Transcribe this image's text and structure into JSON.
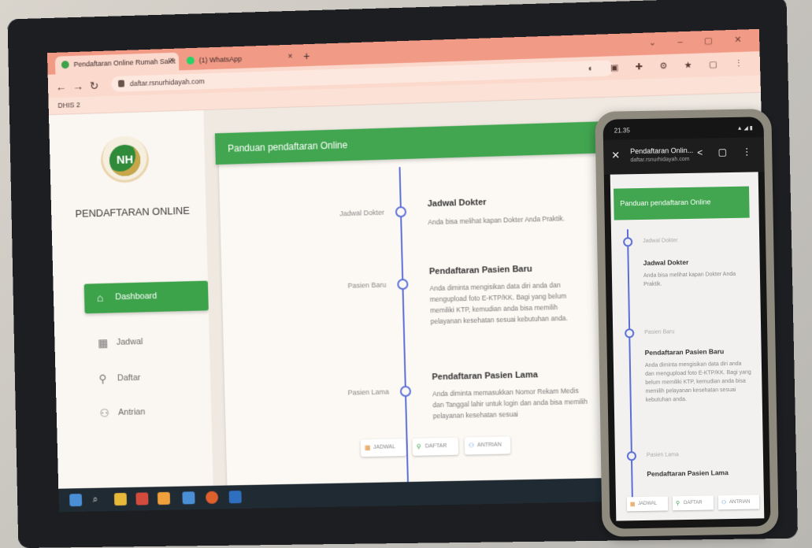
{
  "browser": {
    "tabs": [
      {
        "label": "Pendaftaran Online Rumah Sakit",
        "active": true,
        "favicon_color": "#3da34b"
      },
      {
        "label": "(1) WhatsApp",
        "active": false,
        "favicon_color": "#25d366"
      }
    ],
    "url": "daftar.rsnurhidayah.com",
    "bookmark": "DHIS 2"
  },
  "sidebar": {
    "logo_text": "NH",
    "title": "PENDAFTARAN ONLINE",
    "items": [
      {
        "label": "Dashboard",
        "icon": "home-icon",
        "active": true
      },
      {
        "label": "Jadwal",
        "icon": "calendar-icon",
        "active": false
      },
      {
        "label": "Daftar",
        "icon": "user-add-icon",
        "active": false
      },
      {
        "label": "Antrian",
        "icon": "users-icon",
        "active": false
      }
    ]
  },
  "main": {
    "card_title": "Panduan pendaftaran Online",
    "timeline": [
      {
        "left_label": "Jadwal Dokter",
        "title": "Jadwal Dokter",
        "text": "Anda bisa melihat kapan Dokter Anda Praktik."
      },
      {
        "left_label": "Pasien Baru",
        "title": "Pendaftaran Pasien Baru",
        "text": "Anda diminta mengisikan data diri anda dan mengupload foto E-KTP/KK. Bagi yang belum memiliki KTP, kemudian anda bisa memilih pelayanan kesehatan sesuai kebutuhan anda."
      },
      {
        "left_label": "Pasien Lama",
        "title": "Pendaftaran Pasien Lama",
        "text": "Anda diminta memasukkan Nomor Rekam Medis dan Tanggal lahir untuk login dan anda bisa memilih pelayanan kesehatan sesuai"
      }
    ],
    "bottom_buttons": [
      {
        "label": "JADWAL",
        "icon": "calendar-icon",
        "color": "#e28a2b"
      },
      {
        "label": "DAFTAR",
        "icon": "user-add-icon",
        "color": "#3da34b"
      },
      {
        "label": "ANTRIAN",
        "icon": "users-icon",
        "color": "#4a90d9"
      }
    ]
  },
  "phone": {
    "time": "21.35",
    "page_title": "Pendaftaran Onlin...",
    "url": "daftar.rsnurhidayah.com",
    "card_title": "Panduan pendaftaran Online",
    "timeline": [
      {
        "small": "Jadwal Dokter",
        "title": "Jadwal Dokter",
        "text": "Anda bisa melihat kapan Dokter Anda Praktik."
      },
      {
        "small": "Pasien Baru",
        "title": "Pendaftaran Pasien Baru",
        "text": "Anda diminta mengisikan data diri anda dan mengupload foto E-KTP/KK. Bagi yang belum memiliki KTP, kemudian anda bisa memilih pelayanan kesehatan sesuai kebutuhan anda."
      },
      {
        "small": "Pasien Lama",
        "title": "Pendaftaran Pasien Lama",
        "text": ""
      }
    ],
    "bottom_buttons": [
      {
        "label": "JADWAL"
      },
      {
        "label": "DAFTAR"
      },
      {
        "label": "ANTRIAN"
      }
    ]
  }
}
